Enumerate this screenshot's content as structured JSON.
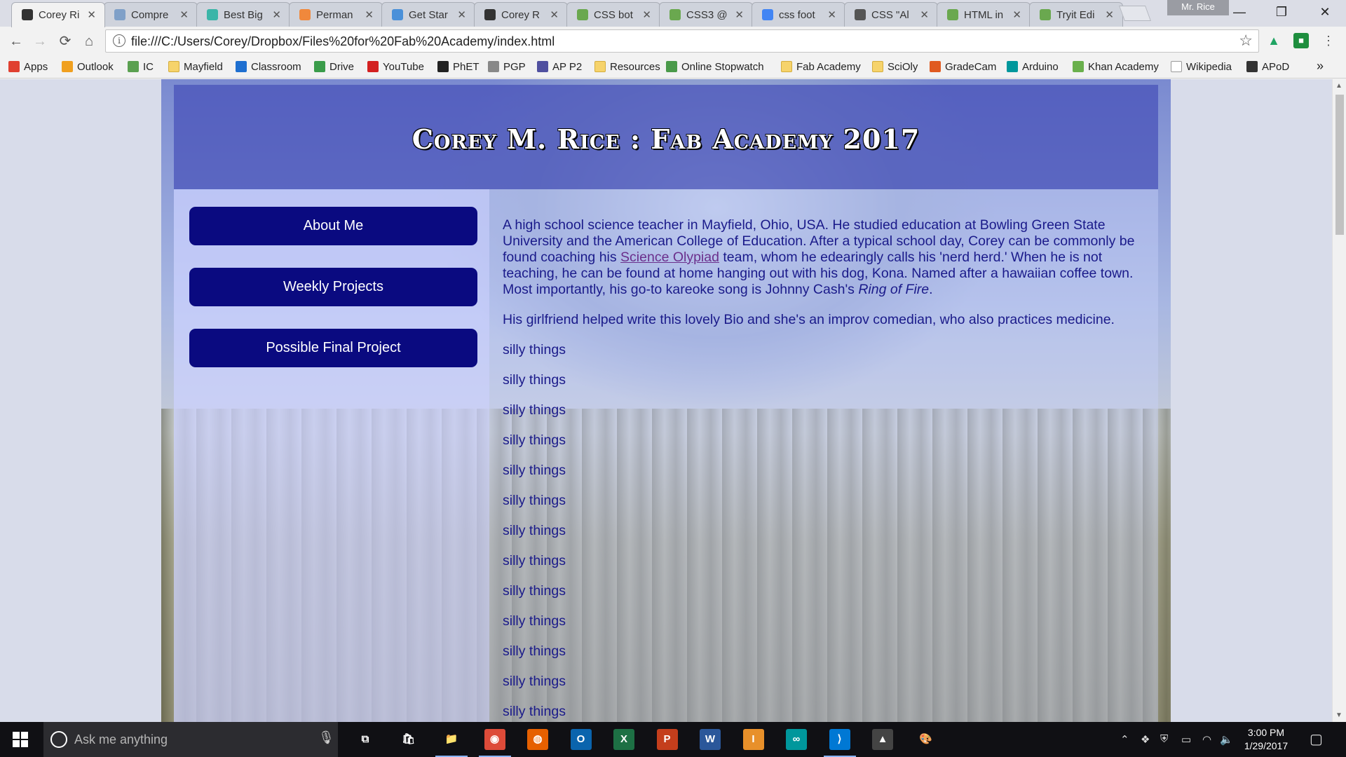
{
  "tabs": [
    {
      "title": "Corey Ri",
      "color": "#333333",
      "active": true
    },
    {
      "title": "Compre",
      "color": "#7fa0c8"
    },
    {
      "title": "Best Big",
      "color": "#3bb5a8"
    },
    {
      "title": "Perman",
      "color": "#f0883c"
    },
    {
      "title": "Get Star",
      "color": "#4a90d9"
    },
    {
      "title": "Corey R",
      "color": "#333333"
    },
    {
      "title": "CSS bot",
      "color": "#6aa84f"
    },
    {
      "title": "CSS3 @",
      "color": "#6aa84f"
    },
    {
      "title": "css foot",
      "color": "#4285f4"
    },
    {
      "title": "CSS \"Al",
      "color": "#555555"
    },
    {
      "title": "HTML in",
      "color": "#6aa84f"
    },
    {
      "title": "Tryit Edi",
      "color": "#6aa84f"
    }
  ],
  "window": {
    "profile": "Mr. Rice",
    "minimize": "—",
    "restore": "❐",
    "close": "✕"
  },
  "toolbar": {
    "back": "←",
    "forward": "→",
    "reload": "⟳",
    "home": "⌂",
    "info": "i",
    "url": "file:///C:/Users/Corey/Dropbox/Files%20for%20Fab%20Academy/index.html",
    "star": "☆",
    "menu": "⋮"
  },
  "bookmarks": [
    {
      "label": "Apps",
      "color": "#e04030"
    },
    {
      "label": "Outlook",
      "color": "#f0a020"
    },
    {
      "label": "IC",
      "color": "#5aa050"
    },
    {
      "label": "Mayfield",
      "color": "folder"
    },
    {
      "label": "Classroom",
      "color": "#1e6fd0"
    },
    {
      "label": "Drive",
      "color": "#3a9c4a"
    },
    {
      "label": "YouTube",
      "color": "#d32020"
    },
    {
      "label": "PhET",
      "color": "#222222"
    },
    {
      "label": "PGP",
      "color": "#888888"
    },
    {
      "label": "AP P2",
      "color": "#5050a0"
    },
    {
      "label": "Resources",
      "color": "folder"
    },
    {
      "label": "Online Stopwatch",
      "color": "#4a9a4a"
    },
    {
      "label": "Fab Academy",
      "color": "folder"
    },
    {
      "label": "SciOly",
      "color": "folder"
    },
    {
      "label": "GradeCam",
      "color": "#e05a20"
    },
    {
      "label": "Arduino",
      "color": "#00979c"
    },
    {
      "label": "Khan Academy",
      "color": "#6ab04c"
    },
    {
      "label": "Wikipedia",
      "color": "#ffffff"
    },
    {
      "label": "APoD",
      "color": "#333333"
    }
  ],
  "bookmarks_more": "»",
  "page": {
    "title": "Corey M. Rice : Fab Academy 2017",
    "nav": [
      "About Me",
      "Weekly Projects",
      "Possible Final Project"
    ],
    "bio": {
      "part1": "A high school science teacher in Mayfield, Ohio, USA. He studied education at Bowling Green State University and the American College of Education. After a typical school day, Corey can be commonly be found coaching his ",
      "link": "Science Olypiad",
      "part2": " team, whom he edearingly calls his 'nerd herd.' When he is not teaching, he can be found at home hanging out with his dog, Kona. Named after a hawaiian coffee town. Most importantly, his go-to kareoke song is Johnny Cash's ",
      "song": "Ring of Fire",
      "part3": "."
    },
    "girlfriend": "His girlfriend helped write this lovely Bio and she's an improv comedian, who also practices medicine.",
    "silly": [
      "silly things",
      "silly things",
      "silly things",
      "silly things",
      "silly things",
      "silly things",
      "silly things",
      "silly things",
      "silly things",
      "silly things",
      "silly things",
      "silly things",
      "silly things"
    ]
  },
  "taskbar": {
    "search_placeholder": "Ask me anything",
    "apps": [
      {
        "name": "task-view",
        "label": "⧉",
        "color": "transparent"
      },
      {
        "name": "store",
        "label": "🛍",
        "color": "transparent"
      },
      {
        "name": "file-explorer",
        "label": "📁",
        "color": "transparent",
        "open": true
      },
      {
        "name": "chrome",
        "label": "◉",
        "color": "#dd4b39",
        "open": true
      },
      {
        "name": "firefox",
        "label": "◍",
        "color": "#e66000"
      },
      {
        "name": "outlook",
        "label": "O",
        "color": "#0a64ad"
      },
      {
        "name": "excel",
        "label": "X",
        "color": "#1d7044"
      },
      {
        "name": "powerpoint",
        "label": "P",
        "color": "#c43e1c"
      },
      {
        "name": "word",
        "label": "W",
        "color": "#2b579a"
      },
      {
        "name": "inkscape-like",
        "label": "I",
        "color": "#e8902a"
      },
      {
        "name": "arduino",
        "label": "∞",
        "color": "#00979c"
      },
      {
        "name": "vscode",
        "label": "⟩",
        "color": "#0078d4",
        "open": true
      },
      {
        "name": "app-triangle",
        "label": "▲",
        "color": "#444444"
      },
      {
        "name": "paint",
        "label": "🎨",
        "color": "transparent"
      }
    ],
    "time": "3:00 PM",
    "date": "1/29/2017"
  }
}
